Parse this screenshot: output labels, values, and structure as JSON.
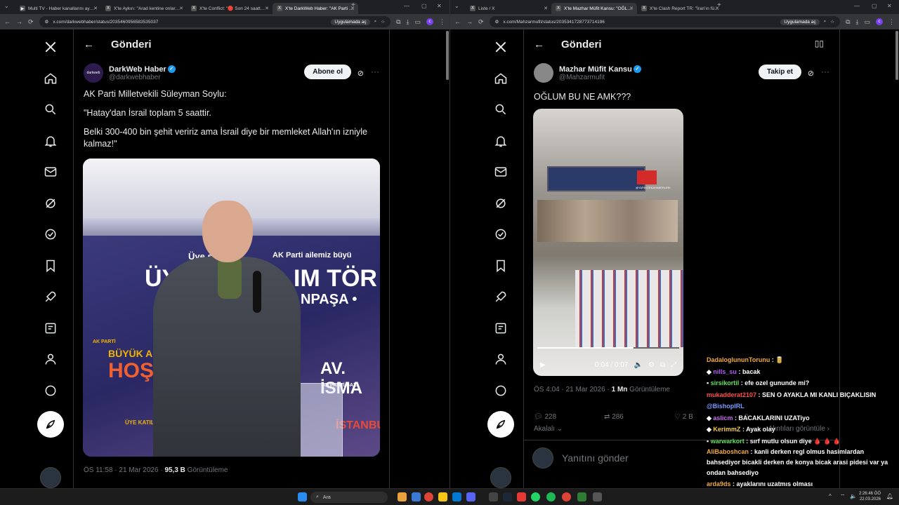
{
  "left": {
    "tabs": [
      "Multi TV - Haber kanallarını ay…",
      "X'te Aykırı: \"Arad kentine onlar…",
      "X'te Conflict: \"🛑 Son 24 saatt…",
      "X'te DarkWeb Haber: \"AK Parti …"
    ],
    "url": "x.com/darkwebhaber/status/2035460956583535037",
    "url_pill": "Uygulamada aç",
    "header_title": "Gönderi",
    "author_name": "DarkWeb Haber",
    "author_handle": "@darkwebhaber",
    "avatar_text": "darkweb",
    "follow_label": "Abone ol",
    "tweet_lines": [
      "AK Parti Milletvekili Süleyman Soylu:",
      "\"Hatay'dan İsrail toplam 5 saattir.",
      "Belki 300-400 bin şehit veririz ama İsrail diye bir memleket Allah'ın izniyle kalmaz!\""
    ],
    "image_texts": {
      "a": "AK Parti ailemiz büyü",
      "b": "ÜY",
      "c": "IM TÖR",
      "d": "NPAŞA •",
      "e": "BÜYÜK A",
      "f": "HOŞ G",
      "g": "AV. İSMA",
      "h": "ÜYE KATILIM TÖRENİ",
      "i": "İSTANBUL",
      "j": "Üye say",
      "k": "AK PARTİ",
      "l": "AK PARTİ GAZİ"
    },
    "meta_time": "ÖS 11:58 · 21 Mar 2026 · ",
    "meta_views": "95,3 B",
    "meta_views_label": " Görüntüleme"
  },
  "right": {
    "tabs": [
      "Liste / X",
      "X'te Mazhar Müfit Kansu: \"OĞL…",
      "X'te Clash Report TR: \"İran'ın fü…"
    ],
    "url": "x.com/Mahzarmufit/status/2035341728773714196",
    "url_pill": "Uygulamada aç",
    "header_title": "Gönderi",
    "author_name": "Mazhar Müfit Kansu",
    "author_handle": "@Mahzarmufit",
    "follow_label": "Takip et",
    "tweet_text": "OĞLUM BU NE AMK???",
    "video_time": "0:04 / 0:07",
    "video_watermark": "@YAPAYZEKAHABERLERI",
    "meta_time": "ÖS 4:04 · 21 Mar 2026 · ",
    "meta_views": "1 Mn",
    "meta_views_label": " Görüntüleme",
    "replies": "228",
    "retweets": "286",
    "likes": "2 B",
    "quotes_label": "Alıntıları görüntüle",
    "related_label": "Akalalı",
    "reply_placeholder": "Yanıtını gönder"
  },
  "chat": [
    {
      "user": "DadaloglununTorunu",
      "msg": "🥫"
    },
    {
      "user": "nills_su",
      "msg": "bacak"
    },
    {
      "user": "sirsikortil",
      "msg": "efe ozel gununde mi?"
    },
    {
      "user": "mukadderat2107",
      "msg": "SEN O AYAKLA MI KANLI BIÇAKLISIN"
    },
    {
      "user": "@BishopIRL",
      "msg": ""
    },
    {
      "user": "aslicm",
      "msg": "BACAKLARINI UZATiyo"
    },
    {
      "user": "KerimmZ",
      "msg": "Ayak olay"
    },
    {
      "user": "warwarkort",
      "msg": "sırf mutlu olsun diye 🩸 🩸 🩸"
    },
    {
      "user": "AliBaboshcan",
      "msg": "kanli derken regl olmus hasimlardan bahsediyor bicakli derken de konya bicak arasi pidesi var ya ondan bahsediyo"
    },
    {
      "user": "arda9ds",
      "msg": "ayaklarını uzatmıs olması"
    }
  ],
  "taskbar": {
    "search_label": "Ara",
    "time": "2:26:46 ÖÖ",
    "date": "22.03.2026"
  }
}
